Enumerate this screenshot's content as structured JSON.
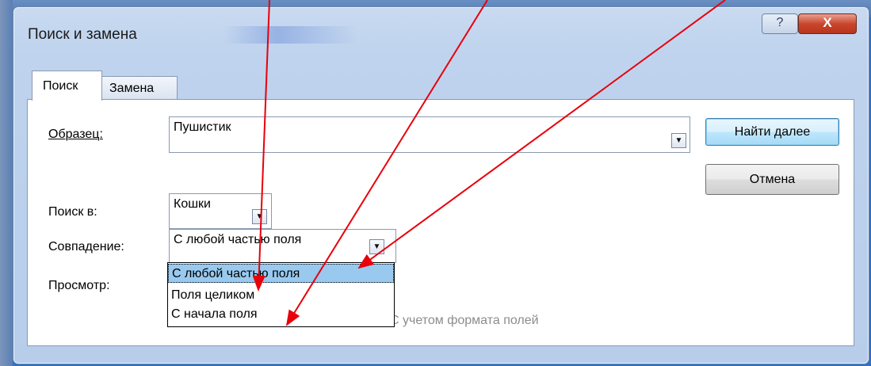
{
  "dialog": {
    "title": "Поиск и замена",
    "help_icon": "?",
    "close_icon": "X"
  },
  "tabs": [
    {
      "label": "Поиск",
      "active": true
    },
    {
      "label": "Замена",
      "active": false
    }
  ],
  "form": {
    "pattern_label": "Образец:",
    "pattern_value": "Пушистик",
    "search_in_label": "Поиск в:",
    "search_in_value": "Кошки",
    "match_label": "Совпадение:",
    "match_value": "С любой частью поля",
    "view_label": "Просмотр:",
    "format_option_label": "С учетом формата полей"
  },
  "buttons": {
    "find_next": "Найти далее",
    "cancel": "Отмена"
  },
  "match_dropdown": {
    "options": [
      "С любой частью поля",
      "Поля целиком",
      "С начала поля"
    ],
    "selected_index": 0
  },
  "icons": {
    "dropdown_arrow": "chevron-down-icon",
    "help": "help-icon",
    "close": "close-icon"
  },
  "colors": {
    "annotation_arrow": "#e8000a",
    "selection_highlight": "#99c9ef",
    "default_button_border": "#3c7fb1"
  }
}
